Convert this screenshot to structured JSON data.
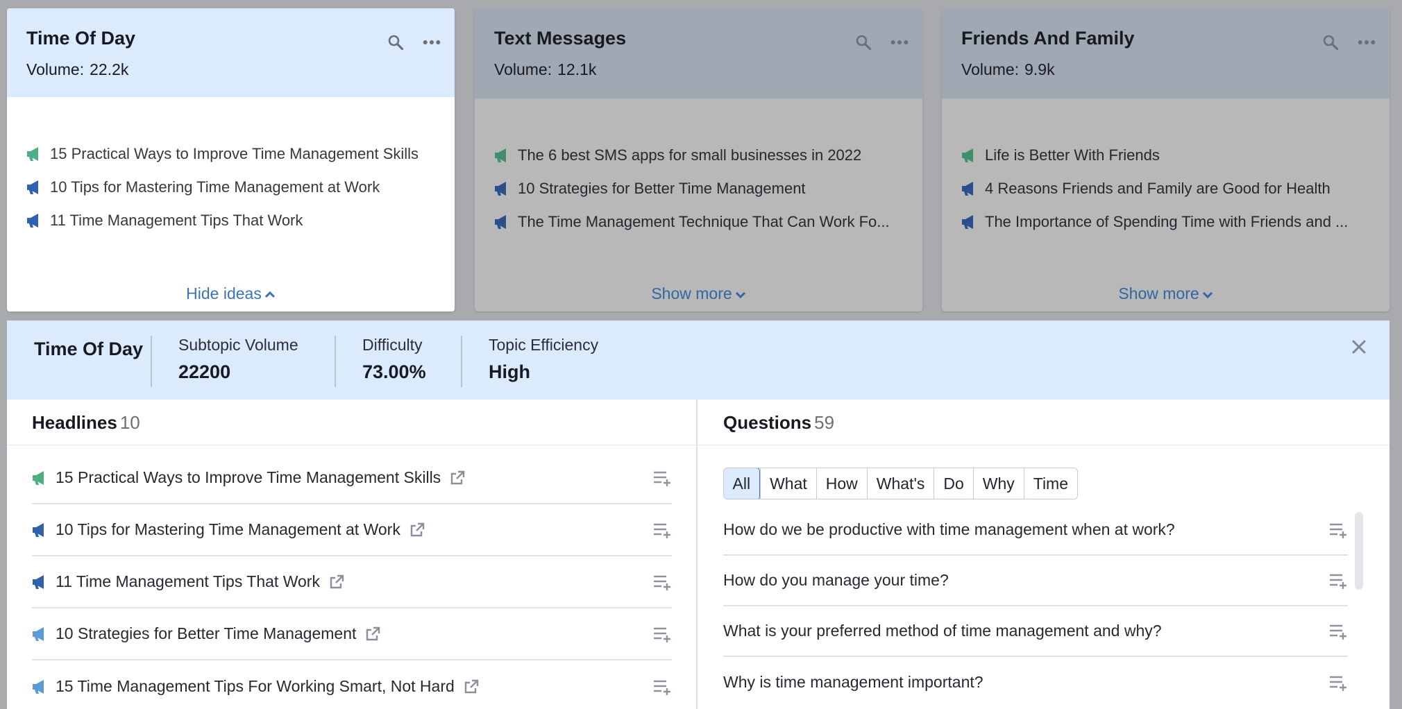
{
  "cards": [
    {
      "title": "Time Of Day",
      "volume_label": "Volume:",
      "volume": "22.2k",
      "ideas": [
        {
          "text": "15 Practical Ways to Improve Time Management Skills",
          "icon": "megaphone-green-icon"
        },
        {
          "text": "10 Tips for Mastering Time Management at Work",
          "icon": "megaphone-blue-icon"
        },
        {
          "text": "11 Time Management Tips That Work",
          "icon": "megaphone-blue-icon"
        }
      ],
      "footer": "Hide ideas"
    },
    {
      "title": "Text Messages",
      "volume_label": "Volume:",
      "volume": "12.1k",
      "ideas": [
        {
          "text": "The 6 best SMS apps for small businesses in 2022",
          "icon": "megaphone-green-icon"
        },
        {
          "text": "10 Strategies for Better Time Management",
          "icon": "megaphone-blue-icon"
        },
        {
          "text": "The Time Management Technique That Can Work Fo...",
          "icon": "megaphone-blue-icon"
        }
      ],
      "footer": "Show more"
    },
    {
      "title": "Friends And Family",
      "volume_label": "Volume:",
      "volume": "9.9k",
      "ideas": [
        {
          "text": "Life is Better With Friends",
          "icon": "megaphone-green-icon"
        },
        {
          "text": "4 Reasons Friends and Family are Good for Health",
          "icon": "megaphone-blue-icon"
        },
        {
          "text": "The Importance of Spending Time with Friends and ...",
          "icon": "megaphone-blue-icon"
        }
      ],
      "footer": "Show more"
    }
  ],
  "summary": {
    "title": "Time Of Day",
    "subtopic_volume_label": "Subtopic Volume",
    "subtopic_volume": "22200",
    "difficulty_label": "Difficulty",
    "difficulty": "73.00%",
    "efficiency_label": "Topic Efficiency",
    "efficiency": "High"
  },
  "headlines": {
    "label": "Headlines",
    "count": "10",
    "items": [
      {
        "text": "15 Practical Ways to Improve Time Management Skills",
        "icon": "megaphone-green-icon"
      },
      {
        "text": "10 Tips for Mastering Time Management at Work",
        "icon": "megaphone-blue-icon"
      },
      {
        "text": "11 Time Management Tips That Work",
        "icon": "megaphone-blue-icon"
      },
      {
        "text": "10 Strategies for Better Time Management",
        "icon": "megaphone-lightblue-icon"
      },
      {
        "text": "15 Time Management Tips For Working Smart, Not Hard",
        "icon": "megaphone-lightblue-icon"
      }
    ]
  },
  "questions": {
    "label": "Questions",
    "count": "59",
    "filters": [
      "All",
      "What",
      "How",
      "What's",
      "Do",
      "Why",
      "Time"
    ],
    "items": [
      "How do we be productive with time management when at work?",
      "How do you manage your time?",
      "What is your preferred method of time management and why?",
      "Why is time management important?"
    ]
  },
  "colors": {
    "accent": "#3a74b6",
    "header_bg": "#dbeafd",
    "megaphone_green": "#4caf82",
    "megaphone_blue": "#2f62ae",
    "megaphone_lightblue": "#5b9bd8"
  }
}
